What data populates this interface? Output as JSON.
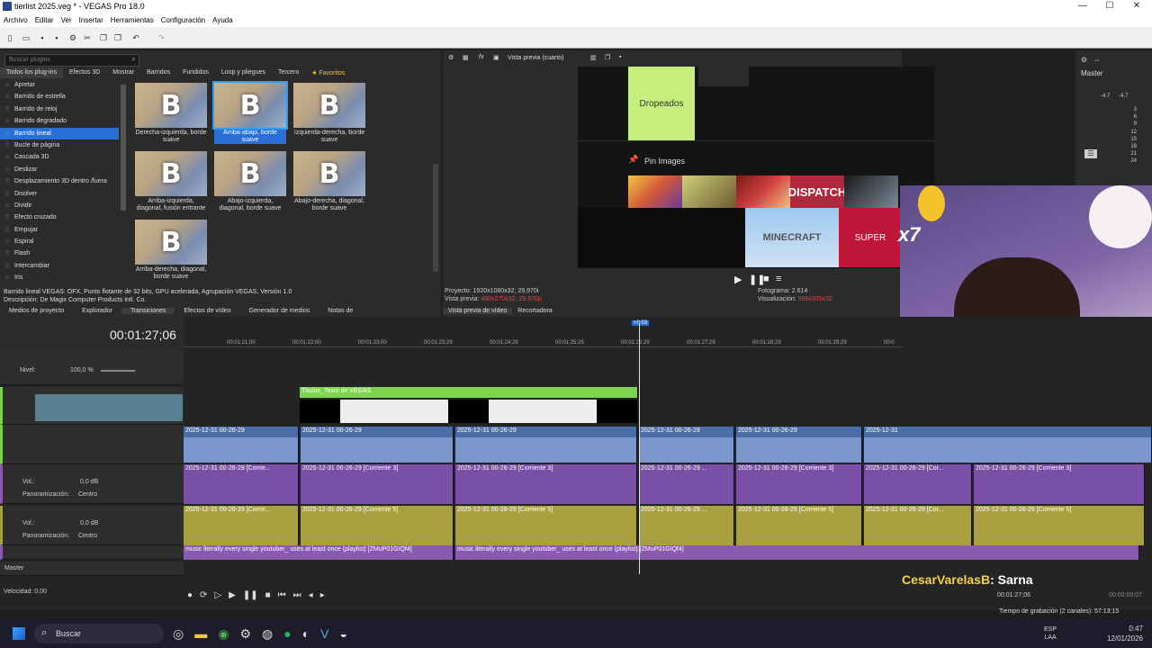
{
  "window": {
    "title": "tierlist 2025.veg * - VEGAS Pro 18.0",
    "min": "—",
    "max": "☐",
    "close": "✕"
  },
  "menu": [
    "Archivo",
    "Editar",
    "Ver",
    "Insertar",
    "Herramientas",
    "Configuración",
    "Ayuda"
  ],
  "plugins": {
    "search_placeholder": "Buscar plugins",
    "tabs": [
      "Todos los plug-ins",
      "Efectos 3D",
      "Mostrar",
      "Barridos",
      "Fundidos",
      "Loop y pliegues",
      "Tercero",
      "★ Favoritos"
    ],
    "list": [
      "Apretar",
      "Barrido de estrella",
      "Barrido de reloj",
      "Barrido degradado",
      "Barrido lineal",
      "Bucle de página",
      "Cascada 3D",
      "Deslizar",
      "Desplazamiento 3D dentro /fuera",
      "Disolver",
      "Dividir",
      "Efecto cruzado",
      "Empujar",
      "Espiral",
      "Flash",
      "Intercambiar",
      "Iris"
    ],
    "selected_index": 4,
    "thumbs": [
      {
        "glyph": "B",
        "label": "Derecha-izquierda, borde suave"
      },
      {
        "glyph": "B",
        "label": "Arriba-abajo, borde suave",
        "selected": true
      },
      {
        "glyph": "B",
        "label": "Izquierda-derecha, borde suave"
      },
      {
        "glyph": "B",
        "label": "Arriba-izquierda, diagonal, fusión entrante"
      },
      {
        "glyph": "B",
        "label": "Abajo-izquierda, diagonal, borde suave"
      },
      {
        "glyph": "B",
        "label": "Abajo-derecha, diagonal, borde suave"
      },
      {
        "glyph": "B",
        "label": "Arriba-derecha, diagonal, borde suave"
      }
    ],
    "desc1": "Barrido lineal VEGAS: OFX, Punto flotante de 32 bits, GPU acelerada, Agrupación VEGAS, Versión 1.0",
    "desc2": "Descripción: De Magix Computer Products Intl. Co.",
    "bottom_tabs": [
      "Medios de proyecto",
      "Explorador",
      "Transiciones",
      "Efectos de vídeo",
      "Generador de medios",
      "Notas de"
    ]
  },
  "preview": {
    "mode": "Vista previa (cuarto)",
    "dropeados": "Dropeados",
    "pin": "Pin Images",
    "proyecto_lbl": "Proyecto:",
    "proyecto": "1920x1080x32; 29,970i",
    "vista_lbl": "Vista previa:",
    "vista": "480x270x32; 29,970p",
    "fotograma_lbl": "Fotograma:",
    "fotograma": "2.614",
    "visual_lbl": "Visualización:",
    "visual": "596x335x32",
    "tabs": [
      "Vista previa de vídeo",
      "Recortadora"
    ],
    "pics": [
      "",
      "",
      "",
      "DISPATCH",
      "",
      "MINECRAFT",
      "SUPER"
    ]
  },
  "master": {
    "label": "Master",
    "l": "-4.7",
    "r": "-4.7",
    "scale": [
      "3",
      "6",
      "9",
      "12",
      "15",
      "18",
      "21",
      "24"
    ]
  },
  "timeline": {
    "timecode": "00:01:27;06",
    "playhead": "+0:03",
    "ruler": [
      "00:01:21;00",
      "00:01:22;00",
      "00:01:23;00",
      "00:01:23;29",
      "00:01:24;29",
      "00:01:25;29",
      "00:01:26;29",
      "00:01:27;29",
      "00:01:28;29",
      "00:01:29;29",
      "00:0"
    ],
    "nivel_lbl": "Nivel:",
    "nivel": "100,0 %",
    "vol_lbl": "Vol.:",
    "vol": "0,0 dB",
    "pan_lbl": "Panoramización:",
    "pan": "Centro",
    "master_lbl": "Master",
    "velocidad": "Velocidad: 0,00",
    "title_clip": "Títulos_Texto de VEGAS",
    "video_clips": [
      "2025-12-31 00-26-29",
      "2025-12-31 00-26-29",
      "2025-12-31 00-26-29",
      "2025-12-31 00-26-29",
      "2025-12-31 00-26-29",
      "2025-12-31"
    ],
    "audio3": [
      "2025-12-31 00-26-29 [Corrie...",
      "2025-12-31 00-26-29 [Corriente 3]",
      "2025-12-31 00-26-29 [Corriente 3]",
      "2025-12-31 00-26-29 ...",
      "2025-12-31 00-26-29 [Corriente 3]",
      "2025-12-31 00-26-29 [Cor...",
      "2025-12-31 00-26-29 [Corriente 3]"
    ],
    "audio5": [
      "2025-12-31 00-26-29 [Corrie...",
      "2025-12-31 00-26-29 [Corriente 5]",
      "2025-12-31 00-26-29 [Corriente 5]",
      "2025-12-31 00-26-29 ...",
      "2025-12-31 00-26-29 [Corriente 5]",
      "2025-12-31 00-26-29 [Cor...",
      "2025-12-31 00-26-29 [Corriente 5]"
    ],
    "music": "music literally every single youtuber_ uses at least once (playlist) [ZMuP01GIQf4]",
    "bottom_tc": "00:01:27;06",
    "bottom_tc2": "00:00:00;07",
    "rec_time": "Tiempo de grabación (2 canales): 57:13:15"
  },
  "chat": {
    "user": "CesarVarelasB",
    "msg": ": Sarna"
  },
  "taskbar": {
    "search": "Buscar",
    "lang": "ESP",
    "lang2": "LAA",
    "time": "0:47",
    "date": "12/01/2026"
  }
}
